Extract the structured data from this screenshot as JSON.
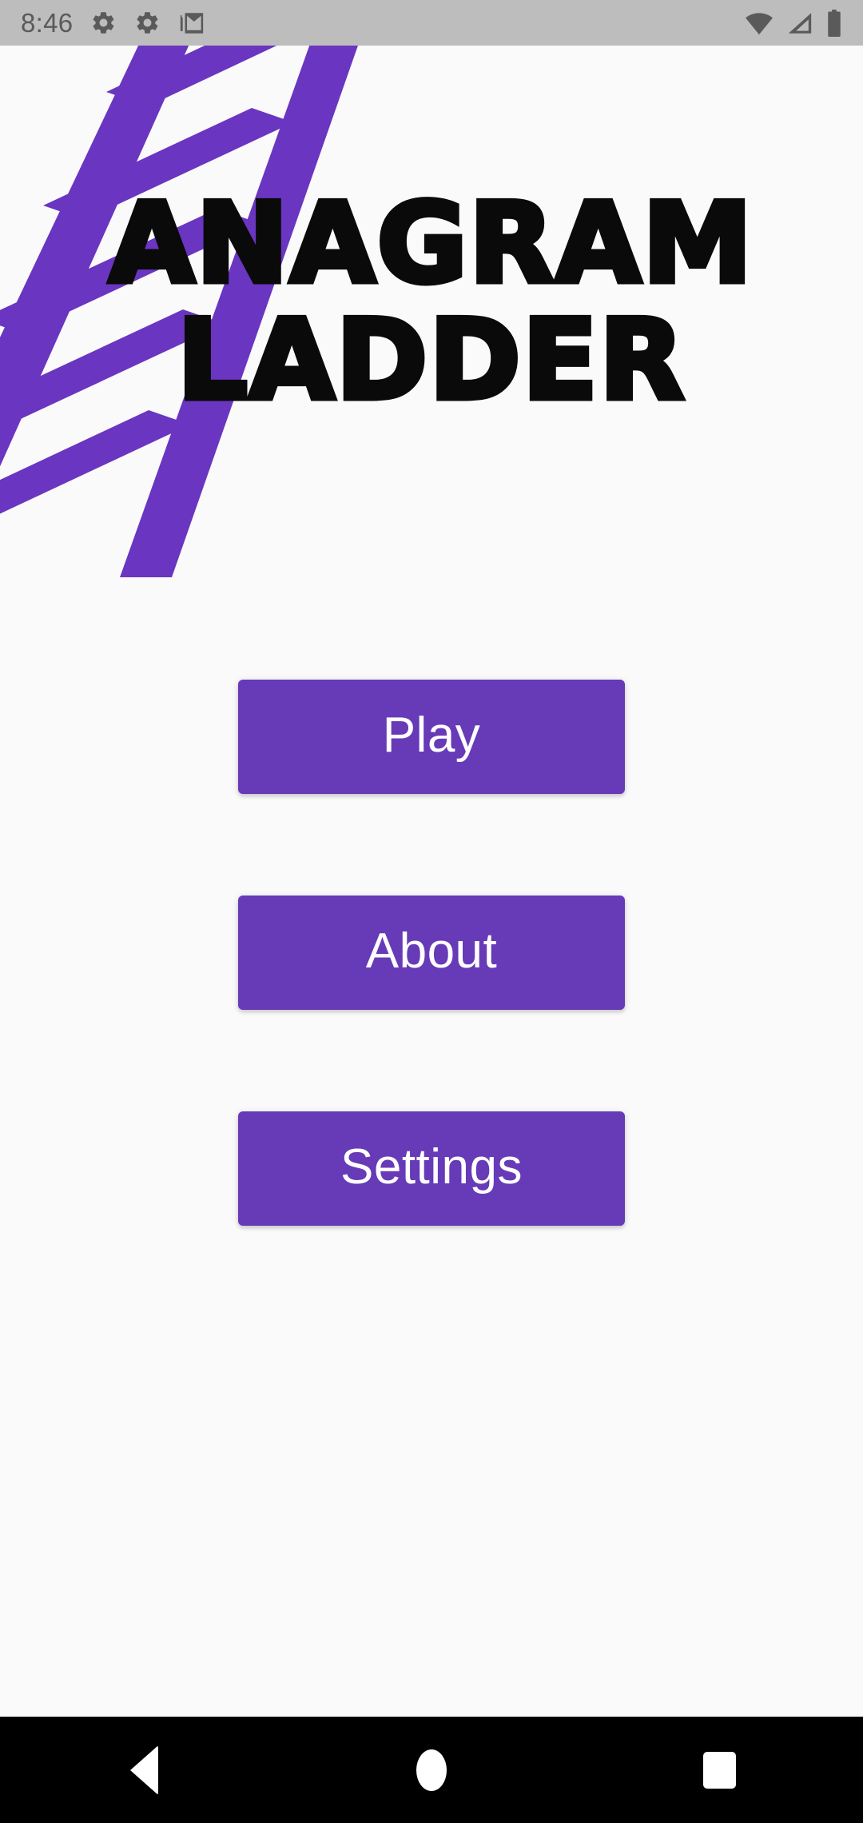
{
  "app": {
    "name": "Anagram Ladder",
    "background_color": "#fafafa",
    "accent_color": "#673ab7"
  },
  "status_bar": {
    "time": "8:46",
    "background_color": "#bdbdbd",
    "foreground_color": "#5a5a5a",
    "left_icons": [
      {
        "name": "settings-gear-icon",
        "glyph": "gear"
      },
      {
        "name": "settings-gear-icon-2",
        "glyph": "gear"
      },
      {
        "name": "gmail-icon",
        "glyph": "envelope-m"
      }
    ],
    "right_icons": [
      {
        "name": "wifi-icon",
        "glyph": "wifi-full"
      },
      {
        "name": "cellular-signal-icon",
        "glyph": "signal-triangle"
      },
      {
        "name": "battery-icon",
        "glyph": "battery-full"
      }
    ]
  },
  "logo": {
    "name": "ladder-illustration",
    "color": "#6a35c0",
    "rung_count": 5
  },
  "title": {
    "line1": "ANAGRAM",
    "line2": "LADDER",
    "color": "#0a0a0a"
  },
  "menu": {
    "buttons": [
      {
        "label": "Play",
        "name": "play-button"
      },
      {
        "label": "About",
        "name": "about-button"
      },
      {
        "label": "Settings",
        "name": "settings-button"
      }
    ],
    "button_color": "#673ab7",
    "button_text_color": "#ffffff"
  },
  "navigation_bar": {
    "background_color": "#000000",
    "buttons": [
      {
        "name": "nav-back-button",
        "icon": "back-triangle-icon"
      },
      {
        "name": "nav-home-button",
        "icon": "home-circle-icon"
      },
      {
        "name": "nav-recents-button",
        "icon": "recents-square-icon"
      }
    ]
  }
}
